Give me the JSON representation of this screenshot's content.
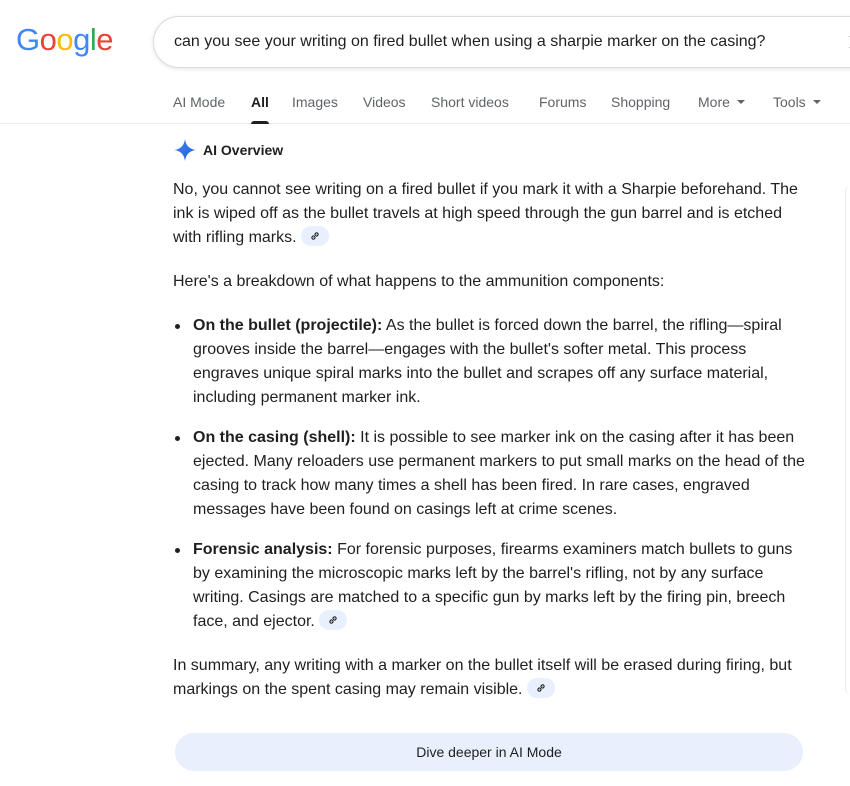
{
  "logo": {
    "text": "Google",
    "letters": [
      {
        "ch": "G",
        "color": "#4285F4"
      },
      {
        "ch": "o",
        "color": "#EA4335"
      },
      {
        "ch": "o",
        "color": "#FBBC05"
      },
      {
        "ch": "g",
        "color": "#4285F4"
      },
      {
        "ch": "l",
        "color": "#34A853"
      },
      {
        "ch": "e",
        "color": "#EA4335"
      }
    ]
  },
  "search": {
    "query": "can you see your writing on fired bullet when using a sharpie marker on the casing?",
    "clear_icon": "close-icon"
  },
  "tabs": {
    "ai_mode": "AI Mode",
    "all": "All",
    "images": "Images",
    "videos": "Videos",
    "short_videos": "Short videos",
    "forums": "Forums",
    "shopping": "Shopping",
    "more": "More",
    "tools": "Tools",
    "active": "All"
  },
  "ai_overview": {
    "title": "AI Overview",
    "icon": "sparkle-icon",
    "intro": "No, you cannot see writing on a fired bullet if you mark it with a Sharpie beforehand. The ink is wiped off as the bullet travels at high speed through the gun barrel and is etched with rifling marks.",
    "breakdown": "Here's a breakdown of what happens to the ammunition components:",
    "bullets": [
      {
        "label": "On the bullet (projectile):",
        "text": " As the bullet is forced down the barrel, the rifling—spiral grooves inside the barrel—engages with the bullet's softer metal. This process engraves unique spiral marks into the bullet and scrapes off any surface material, including permanent marker ink."
      },
      {
        "label": "On the casing (shell):",
        "text": " It is possible to see marker ink on the casing after it has been ejected. Many reloaders use permanent markers to put small marks on the head of the casing to track how many times a shell has been fired. In rare cases, engraved messages have been found on casings left at crime scenes."
      },
      {
        "label": "Forensic analysis:",
        "text": " For forensic purposes, firearms examiners match bullets to guns by examining the microscopic marks left by the barrel's rifling, not by any surface writing. Casings are matched to a specific gun by marks left by the firing pin, breech face, and ejector."
      }
    ],
    "summary": "In summary, any writing with a marker on the bullet itself will be erased during firing, but markings on the spent casing may remain visible.",
    "dive_button": "Dive deeper in AI Mode"
  },
  "colors": {
    "accent_blue": "#4285F4",
    "chip_bg": "#e8f0fe",
    "button_bg": "#e8effd"
  }
}
